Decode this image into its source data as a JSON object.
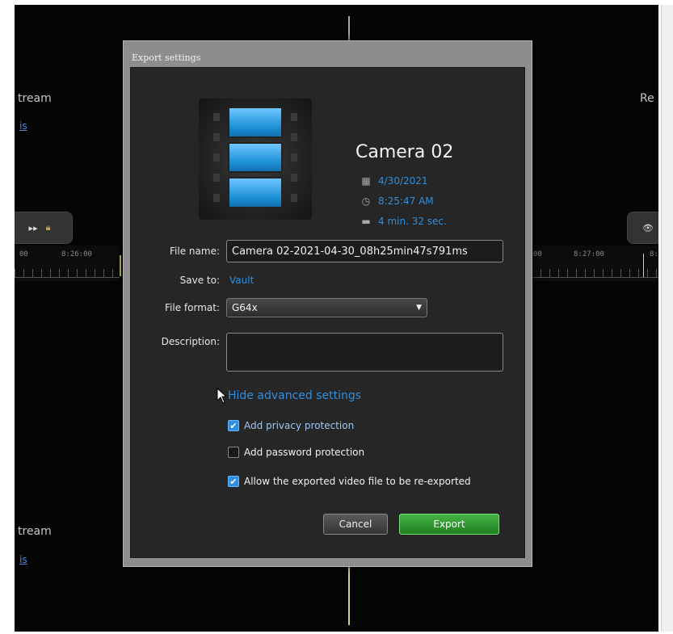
{
  "background": {
    "left_top_text": "tream",
    "left_top_link": "is",
    "left_bottom_text": "tream",
    "left_bottom_link": "is",
    "right_top_text": "Re",
    "left_timeline": {
      "t1": "00",
      "t2": "8:26:00"
    },
    "right_timeline": {
      "t1": "00",
      "t2": "8:27:00",
      "t3": "8:"
    }
  },
  "dialog": {
    "title": "Export settings",
    "camera_name": "Camera 02",
    "date": "4/30/2021",
    "time": "8:25:47 AM",
    "duration": "4 min. 32 sec.",
    "file_name_label": "File name:",
    "file_name_value": "Camera 02-2021-04-30_08h25min47s791ms",
    "save_to_label": "Save to:",
    "save_to_value": "Vault",
    "file_format_label": "File format:",
    "file_format_value": "G64x",
    "description_label": "Description:",
    "description_value": "",
    "advanced_link": "Hide advanced settings",
    "privacy_label": "Add privacy protection",
    "privacy_checked": true,
    "password_label": "Add password protection",
    "password_checked": false,
    "reexport_label": "Allow the exported video file to be re-exported",
    "reexport_checked": true,
    "cancel_label": "Cancel",
    "export_label": "Export"
  },
  "colors": {
    "accent": "#2f8fe0",
    "export": "#2e9a2e"
  },
  "icons": [
    "calendar-icon",
    "clock-icon",
    "duration-icon",
    "film-icon",
    "dropdown-arrow-icon",
    "checkmark-icon",
    "mouse-cursor-icon",
    "eye-icon",
    "play-icon",
    "lock-icon"
  ]
}
